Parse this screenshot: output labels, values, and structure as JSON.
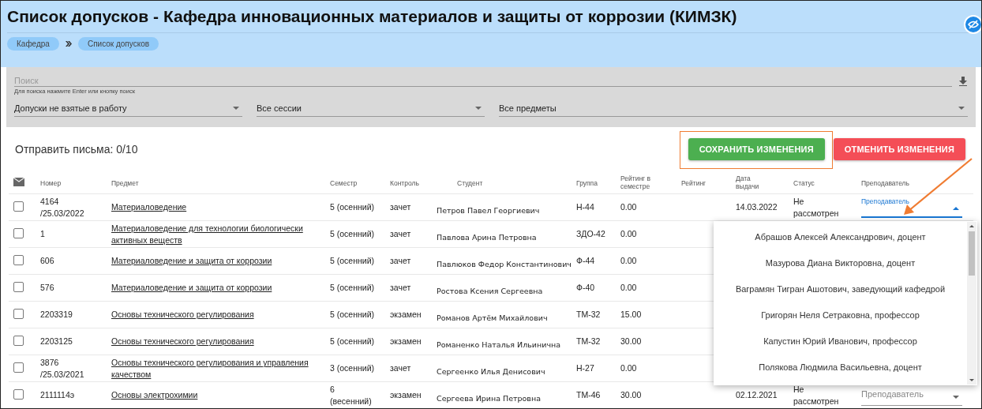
{
  "header": {
    "title": "Список допусков - Кафедра инновационных материалов и защиты от коррозии (КИМЗК)",
    "breadcrumbs": [
      {
        "label": "Кафедра"
      },
      {
        "label": "Список допусков"
      }
    ]
  },
  "filters": {
    "search": {
      "placeholder": "Поиск",
      "hint": "Для поиска нажмите Enter или кнопку поиск"
    },
    "selects": [
      {
        "value": "Допуски не взятые в работу"
      },
      {
        "value": "Все сессии"
      },
      {
        "value": "Все предметы"
      }
    ]
  },
  "send_letters": "Отправить письма: 0/10",
  "buttons": [
    {
      "label": "СОХРАНИТЬ ИЗМЕНЕНИЯ",
      "kind": "save"
    },
    {
      "label": "ОТМЕНИТЬ ИЗМЕНЕНИЯ",
      "kind": "cancel"
    }
  ],
  "table": {
    "columns": [
      "Номер",
      "Предмет",
      "Семестр",
      "Контроль",
      "Студент",
      "Группа",
      "Рейтинг в семестре",
      "Рейтинг",
      "Дата выдачи",
      "Статус",
      "Преподаватель"
    ],
    "rows": [
      {
        "checked": false,
        "number": "4164 /25.03/2022",
        "subject": "Материаловедение",
        "semester": "5 (осенний)",
        "control": "зачет",
        "student": "Петров Павел Георгиевич",
        "group": "Н-44",
        "rating_semester": "0.00",
        "date": "14.03.2022",
        "status": "Не рассмотрен",
        "teacher": {
          "label": "Преподаватель",
          "focused": true
        }
      },
      {
        "checked": false,
        "number": "1",
        "subject": "Материаловедение для технологии биологически активных веществ",
        "semester": "5 (осенний)",
        "control": "зачет",
        "student": "Павлова Арина Петровна",
        "group": "ЗДО-42",
        "rating_semester": "0.00"
      },
      {
        "checked": false,
        "number": "606",
        "subject": "Материаловедение и защита от коррозии",
        "semester": "5 (осенний)",
        "control": "зачет",
        "student": "Павлюков Федор Константинович",
        "group": "Ф-44",
        "rating_semester": "0.00"
      },
      {
        "checked": false,
        "number": "576",
        "subject": "Материаловедение и защита от коррозии",
        "semester": "5 (осенний)",
        "control": "зачет",
        "student": "Ростова Ксения Сергеевна",
        "group": "Ф-40",
        "rating_semester": "0.00"
      },
      {
        "checked": false,
        "number": "2203319",
        "subject": "Основы технического регулирования",
        "semester": "5 (осенний)",
        "control": "экзамен",
        "student": "Романов Артём Михайлович",
        "group": "ТМ-32",
        "rating_semester": "15.00"
      },
      {
        "checked": false,
        "number": "2203125",
        "subject": "Основы технического регулирования",
        "semester": "5 (осенний)",
        "control": "экзамен",
        "student": "Романенко Наталья Ильинична",
        "group": "ТМ-32",
        "rating_semester": "30.00"
      },
      {
        "checked": false,
        "number": "3876 /25.03/2021",
        "subject": "Основы технического регулирования и управления качеством",
        "semester": "3 (осенний)",
        "control": "зачет",
        "student": "Сергеенко Илья Денисович",
        "group": "Н-27",
        "rating_semester": "0.00"
      },
      {
        "checked": false,
        "number": "2111114э",
        "subject": "Основы электрохимии",
        "semester": "6 (весенний)",
        "control": "экзамен",
        "student": "Сергеева Ирина Петровна",
        "group": "ТМ-46",
        "rating_semester": "30.00",
        "date": "02.12.2021",
        "status": "Не рассмотрен",
        "teacher": {
          "placeholder": "Преподаватель",
          "focused": false
        }
      }
    ]
  },
  "teacher_dropdown": {
    "options": [
      {
        "label": "Абрашов Алексей Александрович, доцент",
        "selected": false
      },
      {
        "label": "Мазурова Диана Викторовна, доцент",
        "selected": false
      },
      {
        "label": "Ваграмян Тигран Ашотович, заведующий кафедрой",
        "selected": false
      },
      {
        "label": "Григорян Неля Сетраковна, профессор",
        "selected": false
      },
      {
        "label": "Капустин Юрий Иванович, профессор",
        "selected": false
      },
      {
        "label": "Полякова Людмила Васильевна, доцент",
        "selected": false
      }
    ]
  }
}
